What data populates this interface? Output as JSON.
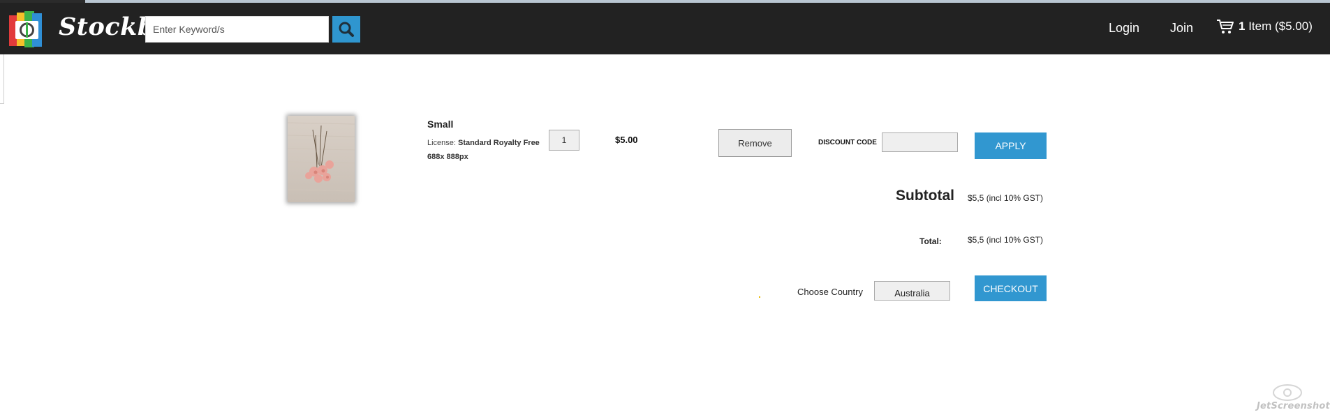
{
  "header": {
    "brand": "Stockbo",
    "search_placeholder": "Enter Keyword/s",
    "login": "Login",
    "join": "Join",
    "cart_count": "1",
    "cart_label": "Item ($5.00)"
  },
  "cart_item": {
    "title": "Small",
    "license_prefix": "License:",
    "license_name": "Standard Royalty Free",
    "dimensions": "688x 888px",
    "quantity": "1",
    "price": "$5.00",
    "remove_label": "Remove"
  },
  "discount": {
    "label": "DISCOUNT CODE",
    "apply_label": "APPLY"
  },
  "summary": {
    "subtotal_label": "Subtotal",
    "subtotal_value": "$5,5 (incl 10% GST)",
    "total_label": "Total:",
    "total_value": "$5,5 (incl 10% GST)"
  },
  "checkout": {
    "country_label": "Choose Country",
    "country_value": "Australia",
    "checkout_label": "CHECKOUT"
  },
  "watermark": "JetScreenshot",
  "colors": {
    "navbar": "#222222",
    "accent_blue": "#3197d0",
    "logo_red": "#e23b3b",
    "logo_yellow": "#f6c02a",
    "logo_green": "#3bb34a",
    "logo_blue": "#2f8fd6"
  }
}
